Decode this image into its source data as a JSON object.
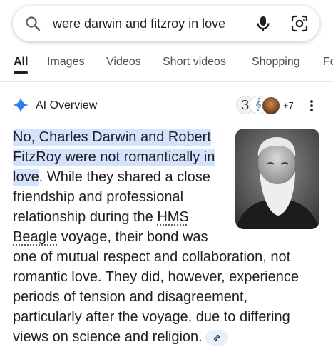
{
  "search": {
    "query": "were darwin and fitzroy in love",
    "icons": {
      "search": "search-icon",
      "mic": "mic-icon",
      "lens": "google-lens-icon"
    }
  },
  "tabs": [
    {
      "label": "All",
      "active": true
    },
    {
      "label": "Images"
    },
    {
      "label": "Videos"
    },
    {
      "label": "Short videos"
    },
    {
      "label": "Shopping"
    },
    {
      "label": "Fo"
    }
  ],
  "ai_overview": {
    "title": "AI Overview",
    "source_count": "+7",
    "source_a_glyph": "3",
    "source_b_glyph": "𝄞",
    "highlight": "No, Charles Darwin and Robert FitzRoy were not romantically in love",
    "text_1": ". While they shared a close friendship and professional relationship during the ",
    "link_text": "HMS Beagle",
    "text_2": " voyage, their bond was one of mutual respect and collaboration, not romantic love. They did, however, experience periods of tension and disagreement, particularly after the voyage, due to differing views on science and religion."
  },
  "colors": {
    "accent_blue": "#1a73e8",
    "highlight_bg": "#d3e3fd",
    "sparkle": "#4285f4"
  }
}
